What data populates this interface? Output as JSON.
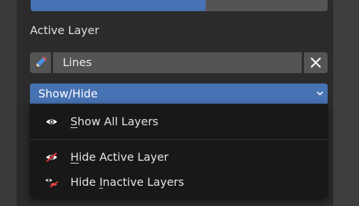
{
  "colors": {
    "accent": "#4772b3",
    "panel": "#2b2b2b",
    "field": "#545454",
    "menu": "#181818"
  },
  "top_bar": {
    "progress": 0.59
  },
  "section": {
    "label": "Active Layer"
  },
  "layer_field": {
    "value": "Lines",
    "icon": "pencil-icon",
    "clear_icon": "close-icon"
  },
  "dropdown": {
    "label": "Show/Hide",
    "icon": "chevron-down-icon"
  },
  "menu": {
    "items": [
      {
        "pre": "",
        "mnemonic": "S",
        "post": "how All Layers",
        "icon": "eye-icon"
      },
      {
        "pre": "",
        "mnemonic": "H",
        "post": "ide Active Layer",
        "icon": "hidden-icon"
      },
      {
        "pre": "Hide ",
        "mnemonic": "I",
        "post": "nactive Layers",
        "icon": "hide-inactive-icon"
      }
    ]
  }
}
